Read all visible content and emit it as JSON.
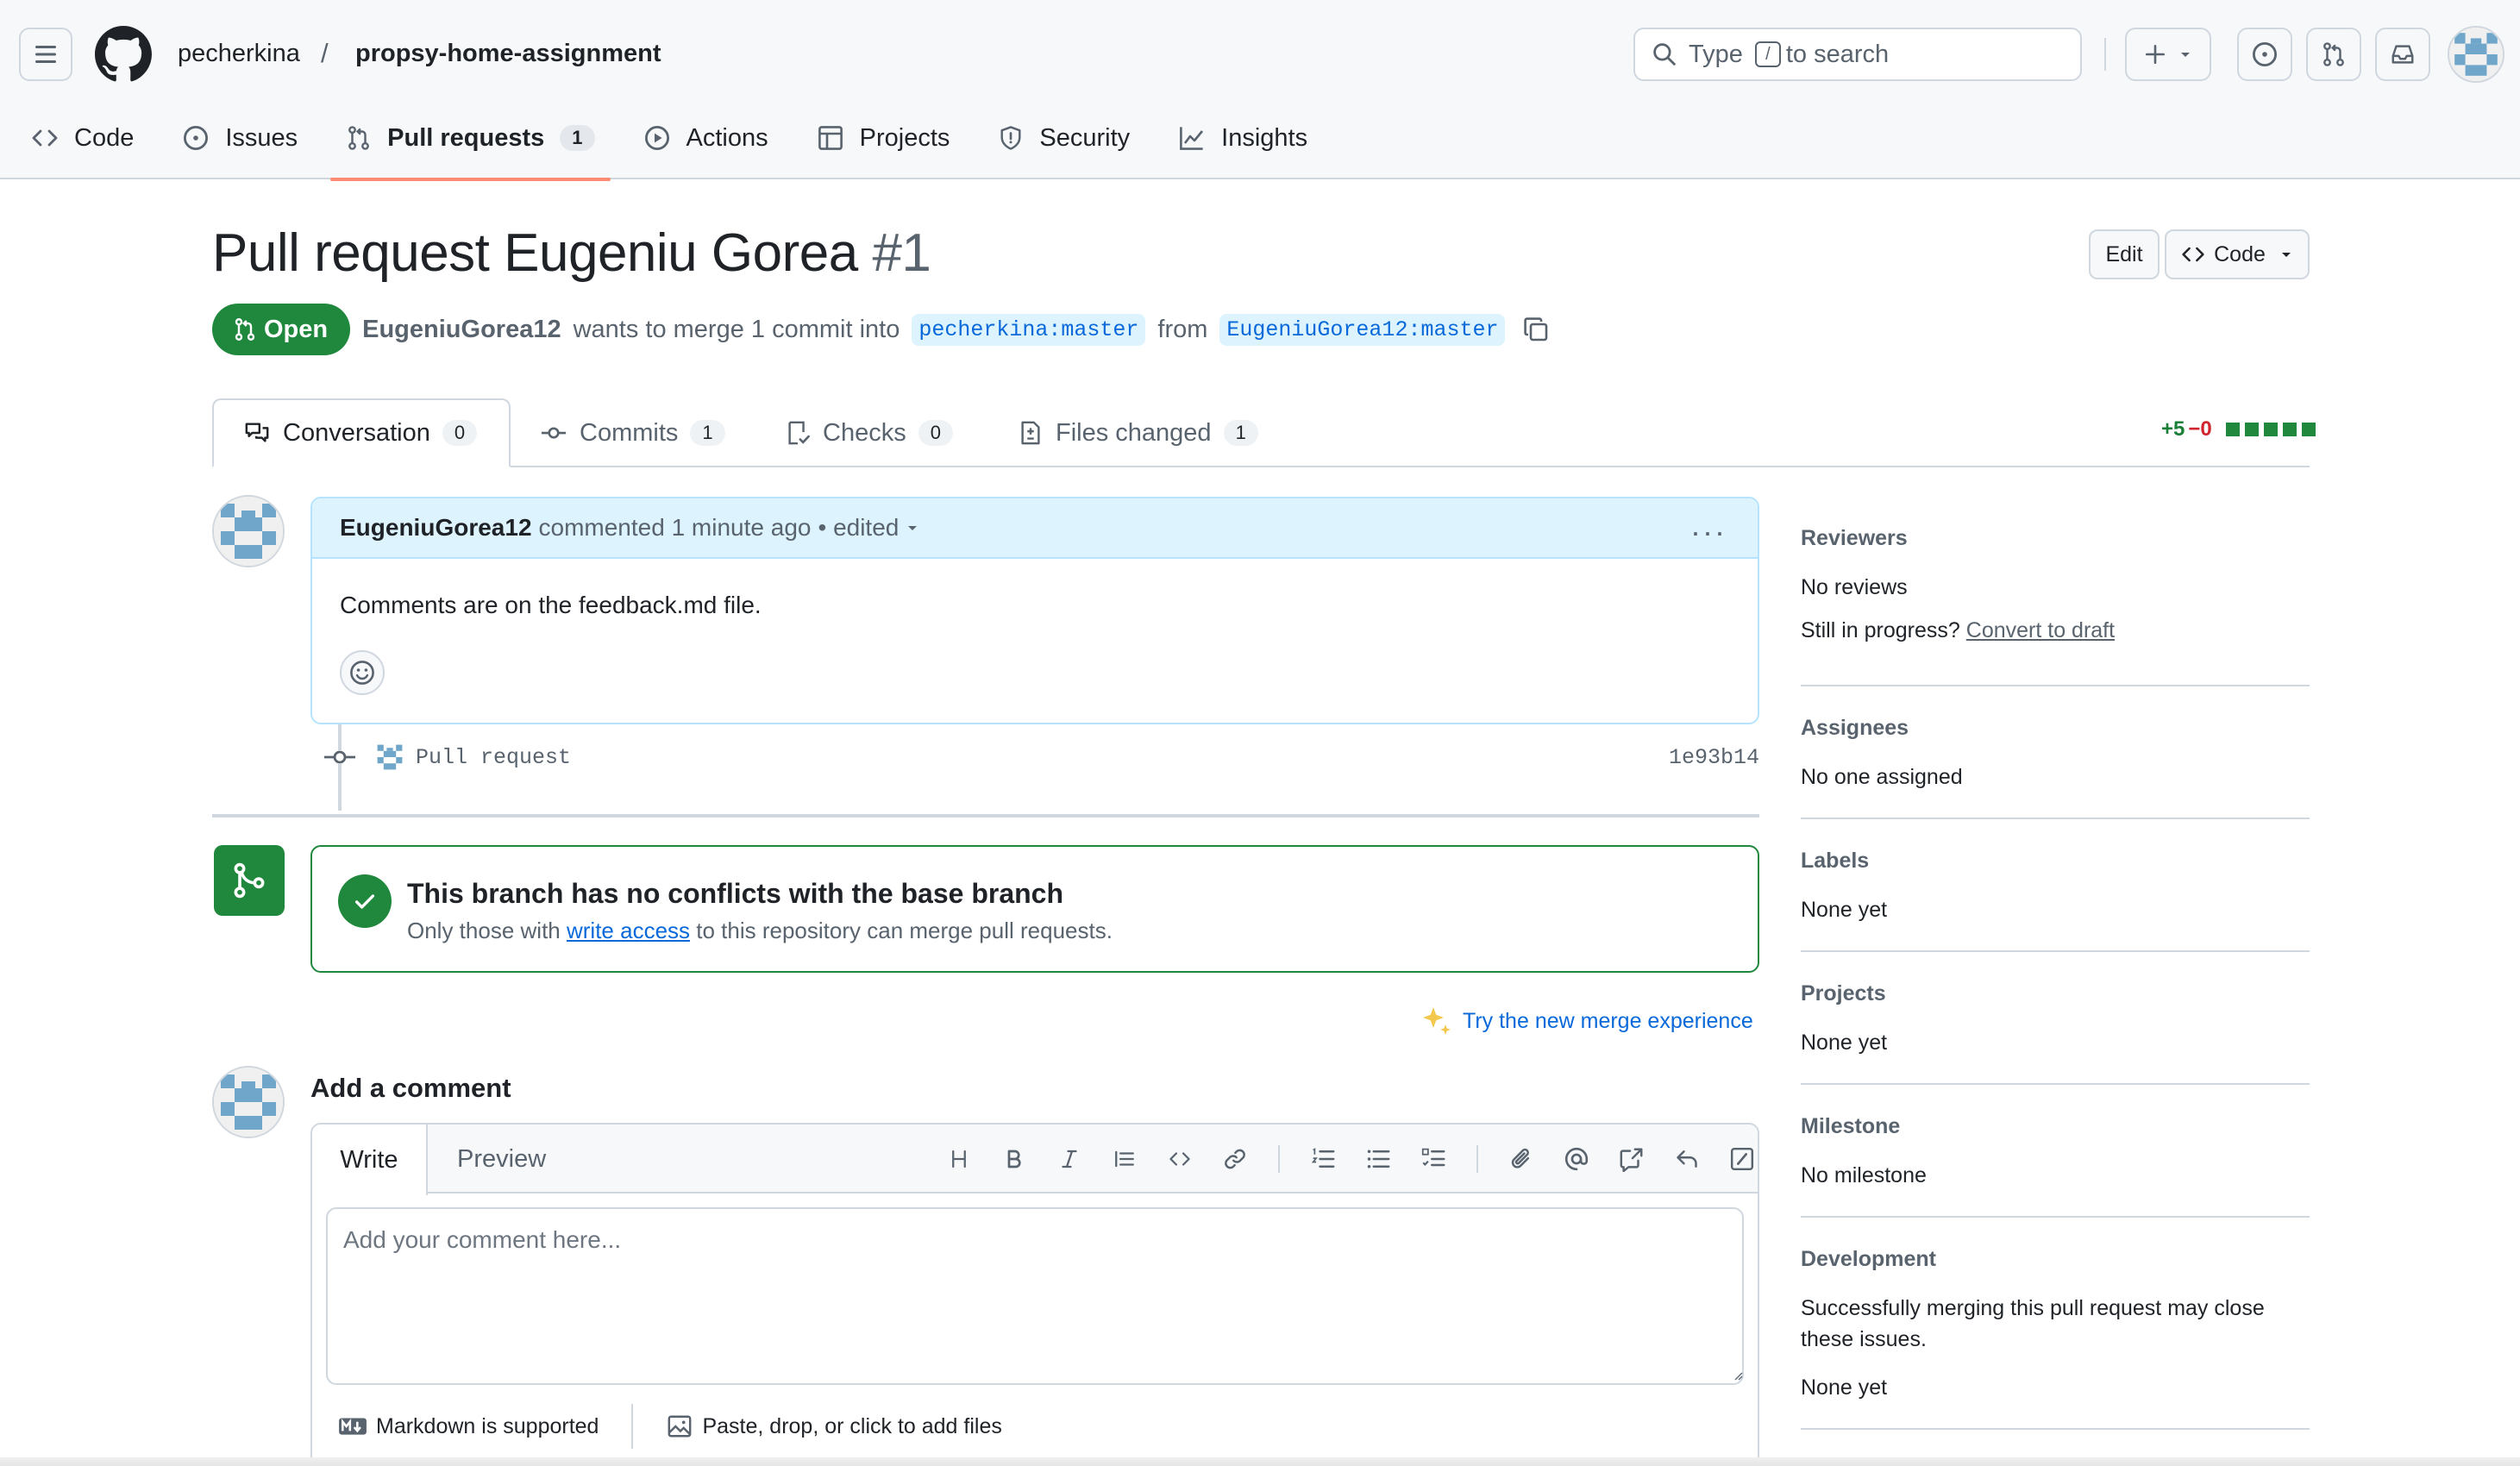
{
  "header": {
    "owner": "pecherkina",
    "separator": "/",
    "repo": "propsy-home-assignment",
    "search_type": "Type",
    "search_key": "/",
    "search_suffix": "to search"
  },
  "repo_tabs": [
    {
      "label": "Code",
      "icon": "code-icon"
    },
    {
      "label": "Issues",
      "icon": "issue-icon"
    },
    {
      "label": "Pull requests",
      "icon": "pull-request-icon",
      "count": "1",
      "selected": true
    },
    {
      "label": "Actions",
      "icon": "play-icon"
    },
    {
      "label": "Projects",
      "icon": "table-icon"
    },
    {
      "label": "Security",
      "icon": "shield-icon"
    },
    {
      "label": "Insights",
      "icon": "graph-icon"
    }
  ],
  "pr": {
    "title": "Pull request Eugeniu Gorea",
    "number": "#1",
    "edit_label": "Edit",
    "code_label": "Code",
    "state": "Open",
    "author": "EugeniuGorea12",
    "merge_text": "wants to merge 1 commit into",
    "base_branch": "pecherkina:master",
    "from_text": "from",
    "head_branch": "EugeniuGorea12:master"
  },
  "pr_tabs": [
    {
      "label": "Conversation",
      "count": "0"
    },
    {
      "label": "Commits",
      "count": "1"
    },
    {
      "label": "Checks",
      "count": "0"
    },
    {
      "label": "Files changed",
      "count": "1"
    }
  ],
  "diffstat": {
    "added": "+5",
    "removed": "−0"
  },
  "comment": {
    "author": "EugeniuGorea12",
    "meta": "commented 1 minute ago",
    "edited": "• edited",
    "body": "Comments are on the feedback.md file.",
    "dots": "···"
  },
  "commit": {
    "message": "Pull request",
    "sha": "1e93b14"
  },
  "merge": {
    "title": "This branch has no conflicts with the base branch",
    "sub_prefix": "Only those with",
    "sub_link": "write access",
    "sub_suffix": "to this repository can merge pull requests.",
    "try_link": "Try the new merge experience"
  },
  "add_comment": {
    "title": "Add a comment",
    "write_tab": "Write",
    "preview_tab": "Preview",
    "placeholder": "Add your comment here...",
    "markdown_note": "Markdown is supported",
    "files_note": "Paste, drop, or click to add files"
  },
  "sidebar": {
    "reviewers": {
      "heading": "Reviewers",
      "value": "No reviews",
      "progress_text": "Still in progress?",
      "progress_link": "Convert to draft"
    },
    "assignees": {
      "heading": "Assignees",
      "value": "No one assigned"
    },
    "labels": {
      "heading": "Labels",
      "value": "None yet"
    },
    "projects": {
      "heading": "Projects",
      "value": "None yet"
    },
    "milestone": {
      "heading": "Milestone",
      "value": "No milestone"
    },
    "development": {
      "heading": "Development",
      "value": "Successfully merging this pull request may close these issues.",
      "value2": "None yet"
    }
  },
  "colors": {
    "accent_green": "#1f883d",
    "link_blue": "#0969da",
    "tab_underline": "#fd8c73",
    "comment_header": "#ddf4ff"
  }
}
